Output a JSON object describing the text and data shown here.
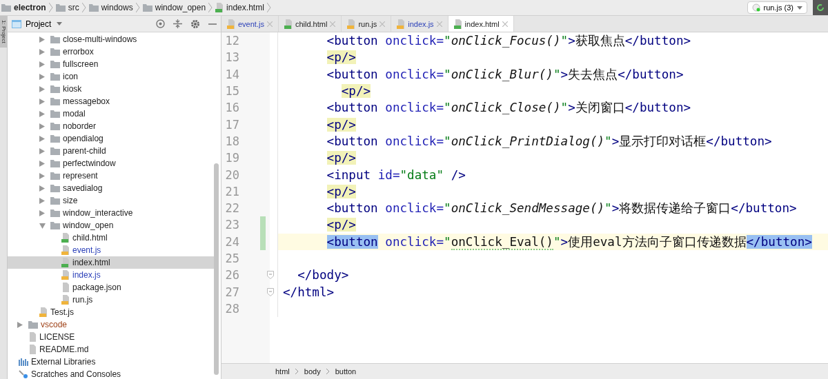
{
  "breadcrumb": [
    {
      "kind": "folder",
      "label": "electron"
    },
    {
      "kind": "folder",
      "label": "src"
    },
    {
      "kind": "folder",
      "label": "windows"
    },
    {
      "kind": "folder",
      "label": "window_open"
    },
    {
      "kind": "html",
      "label": "index.html"
    }
  ],
  "run_config": {
    "label": "run.js (3)"
  },
  "tool_strip": {
    "label": "1: Project"
  },
  "project_header": {
    "label": "Project"
  },
  "tree": [
    {
      "children": [
        {
          "children": [
            {
              "children": [
                {
                  "kind": "folder",
                  "label": "close-multi-windows",
                  "expanded": false,
                  "selected": false
                },
                {
                  "kind": "folder",
                  "label": "errorbox",
                  "expanded": false,
                  "selected": false
                },
                {
                  "kind": "folder",
                  "label": "fullscreen",
                  "expanded": false,
                  "selected": false
                },
                {
                  "kind": "folder",
                  "label": "icon",
                  "expanded": false,
                  "selected": false
                },
                {
                  "kind": "folder",
                  "label": "kiosk",
                  "expanded": false,
                  "selected": false
                },
                {
                  "kind": "folder",
                  "label": "messagebox",
                  "expanded": false,
                  "selected": false
                },
                {
                  "kind": "folder",
                  "label": "modal",
                  "expanded": false,
                  "selected": false
                },
                {
                  "kind": "folder",
                  "label": "noborder",
                  "expanded": false,
                  "selected": false
                },
                {
                  "kind": "folder",
                  "label": "opendialog",
                  "expanded": false,
                  "selected": false
                },
                {
                  "kind": "folder",
                  "label": "parent-child",
                  "expanded": false,
                  "selected": false
                },
                {
                  "kind": "folder",
                  "label": "perfectwindow",
                  "expanded": false,
                  "selected": false
                },
                {
                  "kind": "folder",
                  "label": "represent",
                  "expanded": false,
                  "selected": false
                },
                {
                  "kind": "folder",
                  "label": "savedialog",
                  "expanded": false,
                  "selected": false
                },
                {
                  "kind": "folder",
                  "label": "size",
                  "expanded": false,
                  "selected": false
                },
                {
                  "kind": "folder",
                  "label": "window_interactive",
                  "expanded": false,
                  "selected": false
                },
                {
                  "kind": "folder",
                  "label": "window_open",
                  "expanded": true,
                  "selected": false,
                  "children": [
                    {
                      "kind": "html",
                      "label": "child.html",
                      "selected": false
                    },
                    {
                      "kind": "js",
                      "label": "event.js",
                      "selected": false,
                      "color": "#2a3fb8"
                    },
                    {
                      "kind": "html",
                      "label": "index.html",
                      "selected": true
                    },
                    {
                      "kind": "js",
                      "label": "index.js",
                      "selected": false,
                      "color": "#2a3fb8"
                    },
                    {
                      "kind": "json",
                      "label": "package.json",
                      "selected": false
                    },
                    {
                      "kind": "js",
                      "label": "run.js",
                      "selected": false
                    }
                  ]
                }
              ]
            },
            {
              "kind": "js",
              "label": "Test.js",
              "selected": false
            }
          ]
        },
        {
          "kind": "folder",
          "label": "vscode",
          "expanded": false,
          "selected": false,
          "color": "#a0441a"
        },
        {
          "kind": "file",
          "label": "LICENSE",
          "selected": false
        },
        {
          "kind": "file",
          "label": "README.md",
          "selected": false
        }
      ]
    },
    {
      "kind": "libraries",
      "label": "External Libraries",
      "selected": false
    },
    {
      "kind": "scratches",
      "label": "Scratches and Consoles",
      "selected": false
    }
  ],
  "tabs": [
    {
      "kind": "js",
      "label": "event.js",
      "selected": false,
      "color": "#2a3fb8"
    },
    {
      "kind": "html",
      "label": "child.html",
      "selected": false
    },
    {
      "kind": "js",
      "label": "run.js",
      "selected": false
    },
    {
      "kind": "js",
      "label": "index.js",
      "selected": false,
      "color": "#2a3fb8"
    },
    {
      "kind": "html",
      "label": "index.html",
      "selected": true
    }
  ],
  "code_lines": [
    {
      "number": "12",
      "current": false,
      "changed": false,
      "tokens": [
        {
          "kind": "tag",
          "text": "      <button"
        },
        {
          "kind": "attr",
          "text": " onclick="
        },
        {
          "kind": "quote",
          "text": "\""
        },
        {
          "kind": "call",
          "text": "onClick_Focus()"
        },
        {
          "kind": "quote",
          "text": "\""
        },
        {
          "kind": "tag",
          "text": ">"
        },
        {
          "kind": "text",
          "text": "获取焦点"
        },
        {
          "kind": "tag",
          "text": "</button>"
        }
      ]
    },
    {
      "number": "13",
      "current": false,
      "changed": false,
      "tokens": [
        {
          "kind": "tag",
          "text": "      <p/>",
          "marked": true
        }
      ]
    },
    {
      "number": "14",
      "current": false,
      "changed": false,
      "tokens": [
        {
          "kind": "tag",
          "text": "      <button"
        },
        {
          "kind": "attr",
          "text": " onclick="
        },
        {
          "kind": "quote",
          "text": "\""
        },
        {
          "kind": "call",
          "text": "onClick_Blur()"
        },
        {
          "kind": "quote",
          "text": "\""
        },
        {
          "kind": "tag",
          "text": ">"
        },
        {
          "kind": "text",
          "text": "失去焦点"
        },
        {
          "kind": "tag",
          "text": "</button>"
        }
      ]
    },
    {
      "number": "15",
      "current": false,
      "changed": false,
      "tokens": [
        {
          "kind": "tag",
          "text": "        <p/>",
          "marked": true
        }
      ]
    },
    {
      "number": "16",
      "current": false,
      "changed": false,
      "tokens": [
        {
          "kind": "tag",
          "text": "      <button"
        },
        {
          "kind": "attr",
          "text": " onclick="
        },
        {
          "kind": "quote",
          "text": "\""
        },
        {
          "kind": "call",
          "text": "onClick_Close()"
        },
        {
          "kind": "quote",
          "text": "\""
        },
        {
          "kind": "tag",
          "text": ">"
        },
        {
          "kind": "text",
          "text": "关闭窗口"
        },
        {
          "kind": "tag",
          "text": "</button>"
        }
      ]
    },
    {
      "number": "17",
      "current": false,
      "changed": false,
      "tokens": [
        {
          "kind": "tag",
          "text": "      <p/>",
          "marked": true
        }
      ]
    },
    {
      "number": "18",
      "current": false,
      "changed": false,
      "tokens": [
        {
          "kind": "tag",
          "text": "      <button"
        },
        {
          "kind": "attr",
          "text": " onclick="
        },
        {
          "kind": "quote",
          "text": "\""
        },
        {
          "kind": "call",
          "text": "onClick_PrintDialog()"
        },
        {
          "kind": "quote",
          "text": "\""
        },
        {
          "kind": "tag",
          "text": ">"
        },
        {
          "kind": "text",
          "text": "显示打印对话框"
        },
        {
          "kind": "tag",
          "text": "</button>"
        }
      ]
    },
    {
      "number": "19",
      "current": false,
      "changed": false,
      "tokens": [
        {
          "kind": "tag",
          "text": "      <p/>",
          "marked": true
        }
      ]
    },
    {
      "number": "20",
      "current": false,
      "changed": false,
      "tokens": [
        {
          "kind": "tag",
          "text": "      <input"
        },
        {
          "kind": "attr",
          "text": " id="
        },
        {
          "kind": "string",
          "text": "\"data\""
        },
        {
          "kind": "tag",
          "text": " />"
        }
      ]
    },
    {
      "number": "21",
      "current": false,
      "changed": false,
      "tokens": [
        {
          "kind": "tag",
          "text": "      <p/>",
          "marked": true
        }
      ]
    },
    {
      "number": "22",
      "current": false,
      "changed": false,
      "tokens": [
        {
          "kind": "tag",
          "text": "      <button"
        },
        {
          "kind": "attr",
          "text": " onclick="
        },
        {
          "kind": "quote",
          "text": "\""
        },
        {
          "kind": "call",
          "text": "onClick_SendMessage()"
        },
        {
          "kind": "quote",
          "text": "\""
        },
        {
          "kind": "tag",
          "text": ">"
        },
        {
          "kind": "text",
          "text": "将数据传递给子窗口"
        },
        {
          "kind": "tag",
          "text": "</button>"
        }
      ]
    },
    {
      "number": "23",
      "current": false,
      "changed": true,
      "tokens": [
        {
          "kind": "tag",
          "text": "      <p/>",
          "marked": true
        }
      ]
    },
    {
      "number": "24",
      "current": true,
      "changed": true,
      "tokens": [
        {
          "kind": "tag",
          "text": "      <button",
          "paired": true
        },
        {
          "kind": "attr",
          "text": " onclick="
        },
        {
          "kind": "quote",
          "text": "\""
        },
        {
          "kind": "plain_call",
          "text": "onClick_Eval()",
          "typo": true
        },
        {
          "kind": "quote",
          "text": "\""
        },
        {
          "kind": "tag",
          "text": ">"
        },
        {
          "kind": "text",
          "text": "使用eval方法向子窗口传递数据"
        },
        {
          "kind": "tag",
          "text": "</button>",
          "paired": true
        }
      ]
    },
    {
      "number": "25",
      "current": false,
      "changed": false
    },
    {
      "number": "26",
      "current": false,
      "changed": false,
      "fold": true,
      "tokens": [
        {
          "kind": "tag",
          "text": "  </body>"
        }
      ]
    },
    {
      "number": "27",
      "current": false,
      "changed": false,
      "fold": true,
      "tokens": [
        {
          "kind": "tag",
          "text": "</html>"
        }
      ]
    },
    {
      "number": "28",
      "current": false,
      "changed": false
    }
  ],
  "status_path": [
    "html",
    "body",
    "button"
  ]
}
